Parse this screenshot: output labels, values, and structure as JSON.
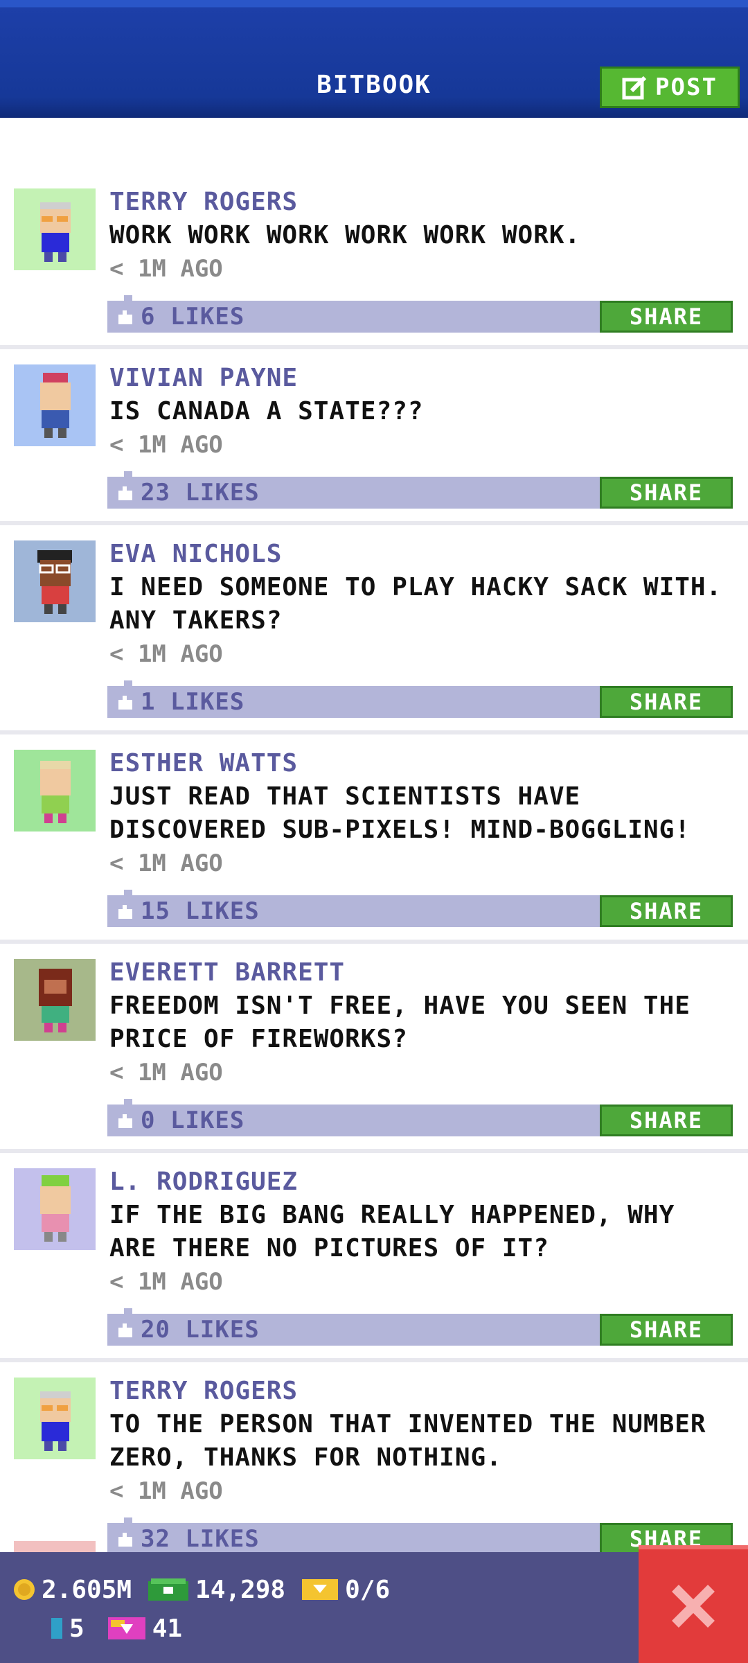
{
  "header": {
    "title": "BITBOOK",
    "post_label": "POST"
  },
  "posts": [
    {
      "name": "TERRY ROGERS",
      "message": "WORK WORK WORK WORK WORK WORK.",
      "time": "< 1M AGO",
      "likes": "6 LIKES",
      "share": "SHARE",
      "avatar_bg": "#c4f2b4"
    },
    {
      "name": "VIVIAN PAYNE",
      "message": "IS CANADA A STATE???",
      "time": "< 1M AGO",
      "likes": "23 LIKES",
      "share": "SHARE",
      "avatar_bg": "#a9c4f4"
    },
    {
      "name": "EVA NICHOLS",
      "message": "I NEED SOMEONE TO PLAY HACKY SACK WITH. ANY TAKERS?",
      "time": "< 1M AGO",
      "likes": "1 LIKES",
      "share": "SHARE",
      "avatar_bg": "#9fb6d8"
    },
    {
      "name": "ESTHER WATTS",
      "message": "JUST READ THAT SCIENTISTS HAVE DISCOVERED SUB-PIXELS! MIND-BOGGLING!",
      "time": "< 1M AGO",
      "likes": "15 LIKES",
      "share": "SHARE",
      "avatar_bg": "#9fe59a"
    },
    {
      "name": "EVERETT BARRETT",
      "message": "FREEDOM ISN'T FREE, HAVE YOU SEEN THE PRICE OF FIREWORKS?",
      "time": "< 1M AGO",
      "likes": "0 LIKES",
      "share": "SHARE",
      "avatar_bg": "#a7b88a"
    },
    {
      "name": "L. RODRIGUEZ",
      "message": "IF THE BIG BANG REALLY HAPPENED, WHY ARE THERE NO PICTURES OF IT?",
      "time": "< 1M AGO",
      "likes": "20 LIKES",
      "share": "SHARE",
      "avatar_bg": "#c3c0ec"
    },
    {
      "name": "TERRY ROGERS",
      "message": "TO THE PERSON THAT INVENTED THE NUMBER ZERO, THANKS FOR NOTHING.",
      "time": "< 1M AGO",
      "likes": "32 LIKES",
      "share": "SHARE",
      "avatar_bg": "#c4f2b4"
    }
  ],
  "footer": {
    "coins": "2.605M",
    "bux": "14,298",
    "tickets": "0/6",
    "elevator": "5",
    "vip": "41"
  },
  "colors": {
    "header": "#163898",
    "accent_green": "#4ea83a",
    "like_bar": "#b3b5d9",
    "name": "#5a5a9e",
    "footer": "#4e4f86",
    "close": "#e23b3b"
  },
  "icons": [
    "edit-icon",
    "thumbs-up-icon",
    "coin-icon",
    "bux-icon",
    "ticket-icon",
    "elevator-icon",
    "vip-icon",
    "close-icon"
  ]
}
